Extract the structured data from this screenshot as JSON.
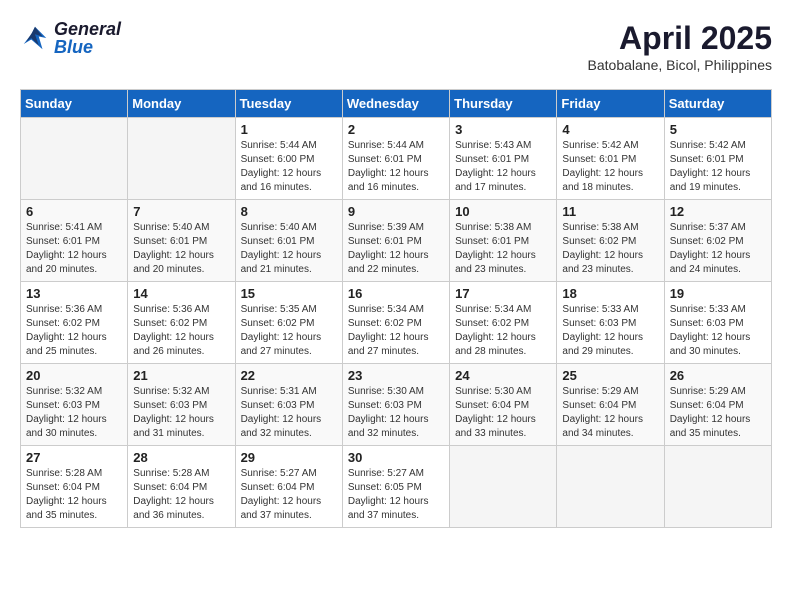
{
  "header": {
    "logo_general": "General",
    "logo_blue": "Blue",
    "month_year": "April 2025",
    "location": "Batobalane, Bicol, Philippines"
  },
  "calendar": {
    "days_of_week": [
      "Sunday",
      "Monday",
      "Tuesday",
      "Wednesday",
      "Thursday",
      "Friday",
      "Saturday"
    ],
    "weeks": [
      [
        {
          "day": "",
          "info": ""
        },
        {
          "day": "",
          "info": ""
        },
        {
          "day": "1",
          "info": "Sunrise: 5:44 AM\nSunset: 6:00 PM\nDaylight: 12 hours\nand 16 minutes."
        },
        {
          "day": "2",
          "info": "Sunrise: 5:44 AM\nSunset: 6:01 PM\nDaylight: 12 hours\nand 16 minutes."
        },
        {
          "day": "3",
          "info": "Sunrise: 5:43 AM\nSunset: 6:01 PM\nDaylight: 12 hours\nand 17 minutes."
        },
        {
          "day": "4",
          "info": "Sunrise: 5:42 AM\nSunset: 6:01 PM\nDaylight: 12 hours\nand 18 minutes."
        },
        {
          "day": "5",
          "info": "Sunrise: 5:42 AM\nSunset: 6:01 PM\nDaylight: 12 hours\nand 19 minutes."
        }
      ],
      [
        {
          "day": "6",
          "info": "Sunrise: 5:41 AM\nSunset: 6:01 PM\nDaylight: 12 hours\nand 20 minutes."
        },
        {
          "day": "7",
          "info": "Sunrise: 5:40 AM\nSunset: 6:01 PM\nDaylight: 12 hours\nand 20 minutes."
        },
        {
          "day": "8",
          "info": "Sunrise: 5:40 AM\nSunset: 6:01 PM\nDaylight: 12 hours\nand 21 minutes."
        },
        {
          "day": "9",
          "info": "Sunrise: 5:39 AM\nSunset: 6:01 PM\nDaylight: 12 hours\nand 22 minutes."
        },
        {
          "day": "10",
          "info": "Sunrise: 5:38 AM\nSunset: 6:01 PM\nDaylight: 12 hours\nand 23 minutes."
        },
        {
          "day": "11",
          "info": "Sunrise: 5:38 AM\nSunset: 6:02 PM\nDaylight: 12 hours\nand 23 minutes."
        },
        {
          "day": "12",
          "info": "Sunrise: 5:37 AM\nSunset: 6:02 PM\nDaylight: 12 hours\nand 24 minutes."
        }
      ],
      [
        {
          "day": "13",
          "info": "Sunrise: 5:36 AM\nSunset: 6:02 PM\nDaylight: 12 hours\nand 25 minutes."
        },
        {
          "day": "14",
          "info": "Sunrise: 5:36 AM\nSunset: 6:02 PM\nDaylight: 12 hours\nand 26 minutes."
        },
        {
          "day": "15",
          "info": "Sunrise: 5:35 AM\nSunset: 6:02 PM\nDaylight: 12 hours\nand 27 minutes."
        },
        {
          "day": "16",
          "info": "Sunrise: 5:34 AM\nSunset: 6:02 PM\nDaylight: 12 hours\nand 27 minutes."
        },
        {
          "day": "17",
          "info": "Sunrise: 5:34 AM\nSunset: 6:02 PM\nDaylight: 12 hours\nand 28 minutes."
        },
        {
          "day": "18",
          "info": "Sunrise: 5:33 AM\nSunset: 6:03 PM\nDaylight: 12 hours\nand 29 minutes."
        },
        {
          "day": "19",
          "info": "Sunrise: 5:33 AM\nSunset: 6:03 PM\nDaylight: 12 hours\nand 30 minutes."
        }
      ],
      [
        {
          "day": "20",
          "info": "Sunrise: 5:32 AM\nSunset: 6:03 PM\nDaylight: 12 hours\nand 30 minutes."
        },
        {
          "day": "21",
          "info": "Sunrise: 5:32 AM\nSunset: 6:03 PM\nDaylight: 12 hours\nand 31 minutes."
        },
        {
          "day": "22",
          "info": "Sunrise: 5:31 AM\nSunset: 6:03 PM\nDaylight: 12 hours\nand 32 minutes."
        },
        {
          "day": "23",
          "info": "Sunrise: 5:30 AM\nSunset: 6:03 PM\nDaylight: 12 hours\nand 32 minutes."
        },
        {
          "day": "24",
          "info": "Sunrise: 5:30 AM\nSunset: 6:04 PM\nDaylight: 12 hours\nand 33 minutes."
        },
        {
          "day": "25",
          "info": "Sunrise: 5:29 AM\nSunset: 6:04 PM\nDaylight: 12 hours\nand 34 minutes."
        },
        {
          "day": "26",
          "info": "Sunrise: 5:29 AM\nSunset: 6:04 PM\nDaylight: 12 hours\nand 35 minutes."
        }
      ],
      [
        {
          "day": "27",
          "info": "Sunrise: 5:28 AM\nSunset: 6:04 PM\nDaylight: 12 hours\nand 35 minutes."
        },
        {
          "day": "28",
          "info": "Sunrise: 5:28 AM\nSunset: 6:04 PM\nDaylight: 12 hours\nand 36 minutes."
        },
        {
          "day": "29",
          "info": "Sunrise: 5:27 AM\nSunset: 6:04 PM\nDaylight: 12 hours\nand 37 minutes."
        },
        {
          "day": "30",
          "info": "Sunrise: 5:27 AM\nSunset: 6:05 PM\nDaylight: 12 hours\nand 37 minutes."
        },
        {
          "day": "",
          "info": ""
        },
        {
          "day": "",
          "info": ""
        },
        {
          "day": "",
          "info": ""
        }
      ]
    ]
  }
}
